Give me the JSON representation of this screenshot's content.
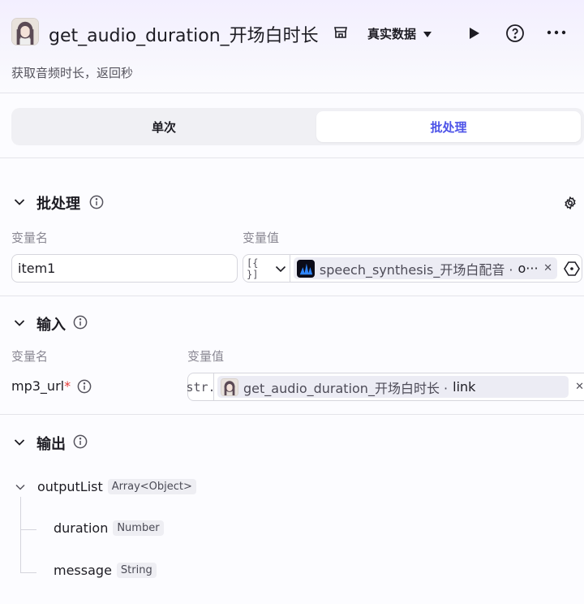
{
  "header": {
    "title": "get_audio_duration_开场白时长",
    "subtitle": "获取音频时长，返回秒",
    "mode_dropdown": "真实数据"
  },
  "tabs": [
    {
      "label": "单次"
    },
    {
      "label": "批处理"
    }
  ],
  "batch": {
    "title": "批处理",
    "col_name": "变量名",
    "col_value": "变量值",
    "item_name": "item1",
    "item_ref_prefix": "[{ }]",
    "item_ref_node": "speech_synthesis_开场白配音 · ",
    "item_ref_field": "o···"
  },
  "input": {
    "title": "输入",
    "col_name": "变量名",
    "col_value": "变量值",
    "param_name": "mp3_url",
    "required_mark": "*",
    "type_prefix": "str.",
    "ref_node": "get_audio_duration_开场白时长 · ",
    "ref_field": "link"
  },
  "output": {
    "title": "输出",
    "root": {
      "name": "outputList",
      "type": "Array<Object>"
    },
    "children": [
      {
        "name": "duration",
        "type": "Number"
      },
      {
        "name": "message",
        "type": "String"
      }
    ]
  },
  "colors": {
    "accent": "#4d53e8",
    "required": "#e53935"
  }
}
